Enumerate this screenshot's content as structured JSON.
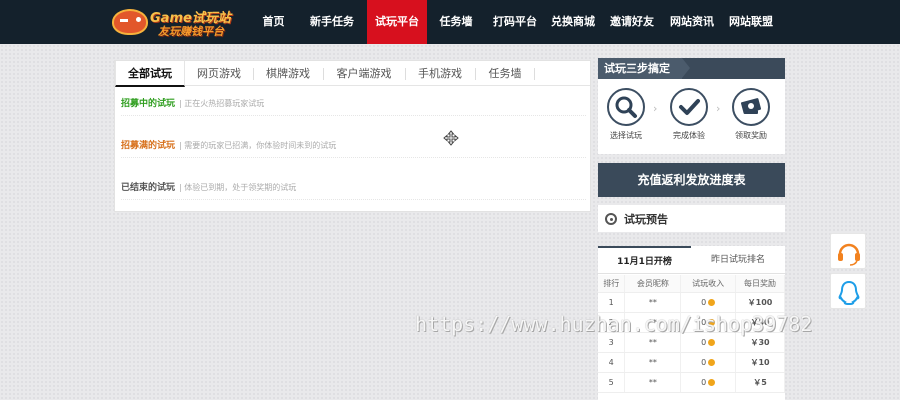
{
  "logo": {
    "line1": "Game试玩站",
    "line2": "友玩赚钱平台"
  },
  "nav": {
    "items": [
      {
        "label": "首页",
        "active": false
      },
      {
        "label": "新手任务",
        "active": false
      },
      {
        "label": "试玩平台",
        "active": true
      },
      {
        "label": "任务墙",
        "active": false
      },
      {
        "label": "打码平台",
        "active": false
      },
      {
        "label": "兑换商城",
        "active": false
      },
      {
        "label": "邀请好友",
        "active": false
      },
      {
        "label": "网站资讯",
        "active": false
      },
      {
        "label": "网站联盟",
        "active": false
      }
    ]
  },
  "main": {
    "tabs": [
      {
        "label": "全部试玩",
        "active": true
      },
      {
        "label": "网页游戏",
        "active": false
      },
      {
        "label": "棋牌游戏",
        "active": false
      },
      {
        "label": "客户端游戏",
        "active": false
      },
      {
        "label": "手机游戏",
        "active": false
      },
      {
        "label": "任务墙",
        "active": false
      }
    ],
    "sections": [
      {
        "title": "招募中的试玩",
        "desc": "| 正在火热招募玩家试玩",
        "color": "#2f9e1f"
      },
      {
        "title": "招募满的试玩",
        "desc": "| 需要的玩家已招满，你体验时间未到的试玩",
        "color": "#d7701b"
      },
      {
        "title": "已结束的试玩",
        "desc": "| 体验已到期，处于领奖期的试玩",
        "color": "#555555"
      }
    ]
  },
  "steps": {
    "title": "试玩三步搞定",
    "items": [
      {
        "label": "选择试玩",
        "icon": "search-icon"
      },
      {
        "label": "完成体验",
        "icon": "check-icon"
      },
      {
        "label": "领取奖励",
        "icon": "money-icon"
      }
    ]
  },
  "recharge": {
    "label": "充值返利发放进度表"
  },
  "preview": {
    "label": "试玩预告"
  },
  "ranking": {
    "tabs": [
      {
        "label": "11月1日开榜",
        "active": true
      },
      {
        "label": "昨日试玩排名",
        "active": false
      }
    ],
    "headers": [
      "排行",
      "会员昵称",
      "试玩收入",
      "每日奖励"
    ],
    "rows": [
      {
        "rank": "1",
        "name": "**",
        "income": "0",
        "reward": "￥100"
      },
      {
        "rank": "2",
        "name": "**",
        "income": "0",
        "reward": "￥50"
      },
      {
        "rank": "3",
        "name": "**",
        "income": "0",
        "reward": "￥30"
      },
      {
        "rank": "4",
        "name": "**",
        "income": "0",
        "reward": "￥10"
      },
      {
        "rank": "5",
        "name": "**",
        "income": "0",
        "reward": "￥5"
      }
    ]
  },
  "float_buttons": [
    {
      "icon": "headset-icon"
    },
    {
      "icon": "qq-penguin-icon"
    }
  ],
  "watermark": "https://www.huzhan.com/ishop39782"
}
